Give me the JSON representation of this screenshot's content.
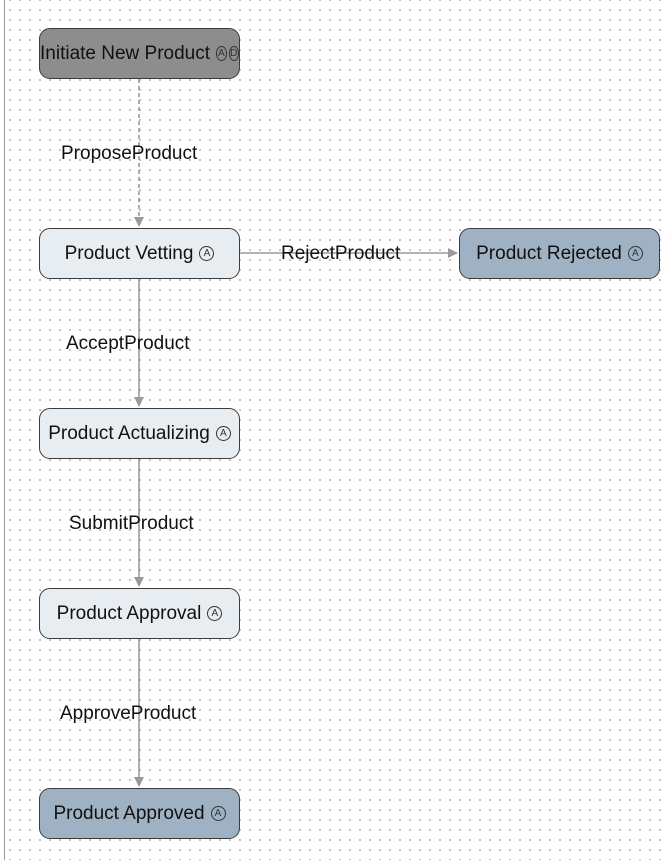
{
  "nodes": {
    "initiate": {
      "label": "Initiate New Product",
      "badge1": "A",
      "badge2": "D"
    },
    "vetting": {
      "label": "Product Vetting",
      "badge1": "A"
    },
    "rejected": {
      "label": "Product Rejected",
      "badge1": "A"
    },
    "actualizing": {
      "label": "Product Actualizing",
      "badge1": "A"
    },
    "approval": {
      "label": "Product Approval",
      "badge1": "A"
    },
    "approved": {
      "label": "Product Approved",
      "badge1": "A"
    }
  },
  "edges": {
    "propose": "ProposeProduct",
    "reject": "RejectProduct",
    "accept": "AcceptProduct",
    "submit": "SubmitProduct",
    "approve": "ApproveProduct"
  },
  "colors": {
    "start_node": "#8d8d8d",
    "mid_node": "#e8edf2",
    "end_node": "#9fb2c4",
    "edge": "#9a9a9a"
  }
}
